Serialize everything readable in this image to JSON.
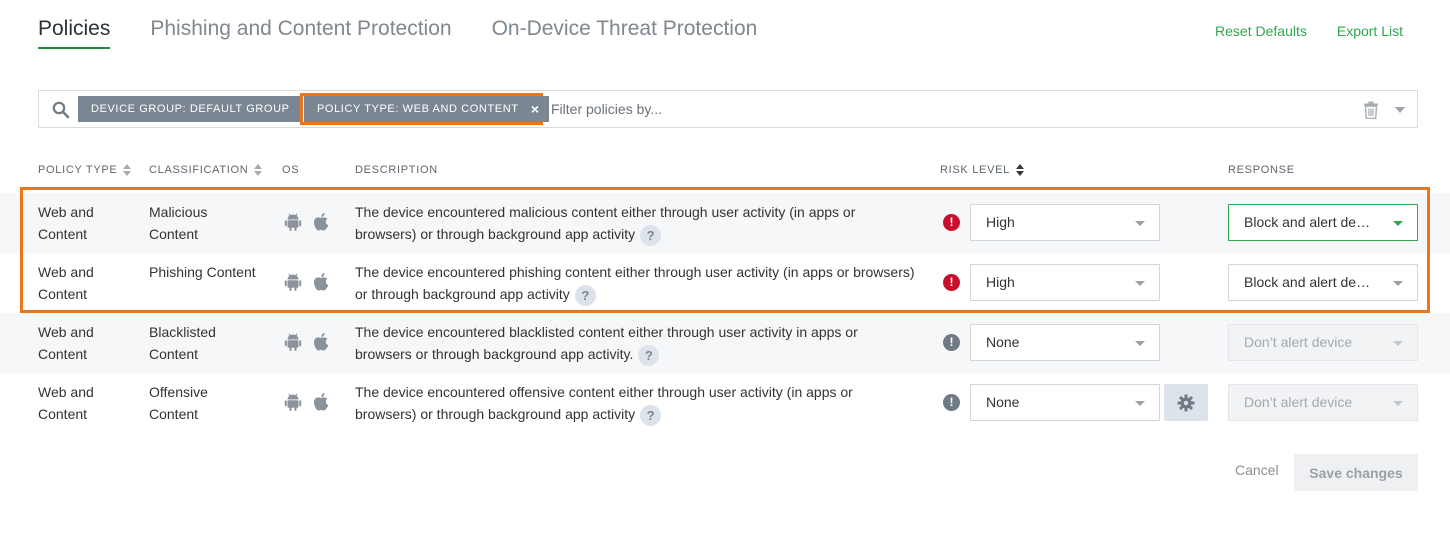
{
  "tabs": [
    {
      "label": "Policies",
      "active": true
    },
    {
      "label": "Phishing and Content Protection",
      "active": false
    },
    {
      "label": "On-Device Threat Protection",
      "active": false
    }
  ],
  "actions": {
    "reset": "Reset Defaults",
    "export": "Export List"
  },
  "filter": {
    "chips": [
      "DEVICE GROUP: DEFAULT GROUP",
      "POLICY TYPE: WEB AND CONTENT"
    ],
    "chip_remove": "×",
    "placeholder": "Filter policies by..."
  },
  "columns": {
    "type": "POLICY TYPE",
    "classification": "CLASSIFICATION",
    "os": "OS",
    "description": "DESCRIPTION",
    "risk": "RISK LEVEL",
    "response": "RESPONSE"
  },
  "rows": [
    {
      "type": "Web and Content",
      "classification": "Malicious Content",
      "os": [
        "android-icon",
        "apple-icon"
      ],
      "description": "The device encountered malicious content either through user activity (in apps or browsers) or through background app activity",
      "risk_icon": "!",
      "risk": "High",
      "response": "Block and alert device",
      "help": "?"
    },
    {
      "type": "Web and Content",
      "classification": "Phishing Content",
      "os": [
        "android-icon",
        "apple-icon"
      ],
      "description": "The device encountered phishing content either through user activity (in apps or browsers) or through background app activity",
      "risk_icon": "!",
      "risk": "High",
      "response": "Block and alert device",
      "help": "?"
    },
    {
      "type": "Web and Content",
      "classification": "Blacklisted Content",
      "os": [
        "android-icon",
        "apple-icon"
      ],
      "description": "The device encountered blacklisted content either through user activity in apps or browsers or through background app activity.",
      "risk_icon": "!",
      "risk": "None",
      "response": "Don’t alert device",
      "help": "?"
    },
    {
      "type": "Web and Content",
      "classification": "Offensive Content",
      "os": [
        "android-icon",
        "apple-icon"
      ],
      "description": "The device encountered offensive content either through user activity (in apps or browsers) or through background app activity",
      "risk_icon": "!",
      "risk": "None",
      "response": "Don’t alert device",
      "help": "?"
    }
  ],
  "footer": {
    "cancel": "Cancel",
    "save": "Save changes"
  },
  "colors": {
    "accent_green": "#2fa84f",
    "risk_high": "#c8102e",
    "risk_none": "#6f7a85",
    "highlight_orange": "#e8761d",
    "chip_bg": "#7a8793"
  }
}
